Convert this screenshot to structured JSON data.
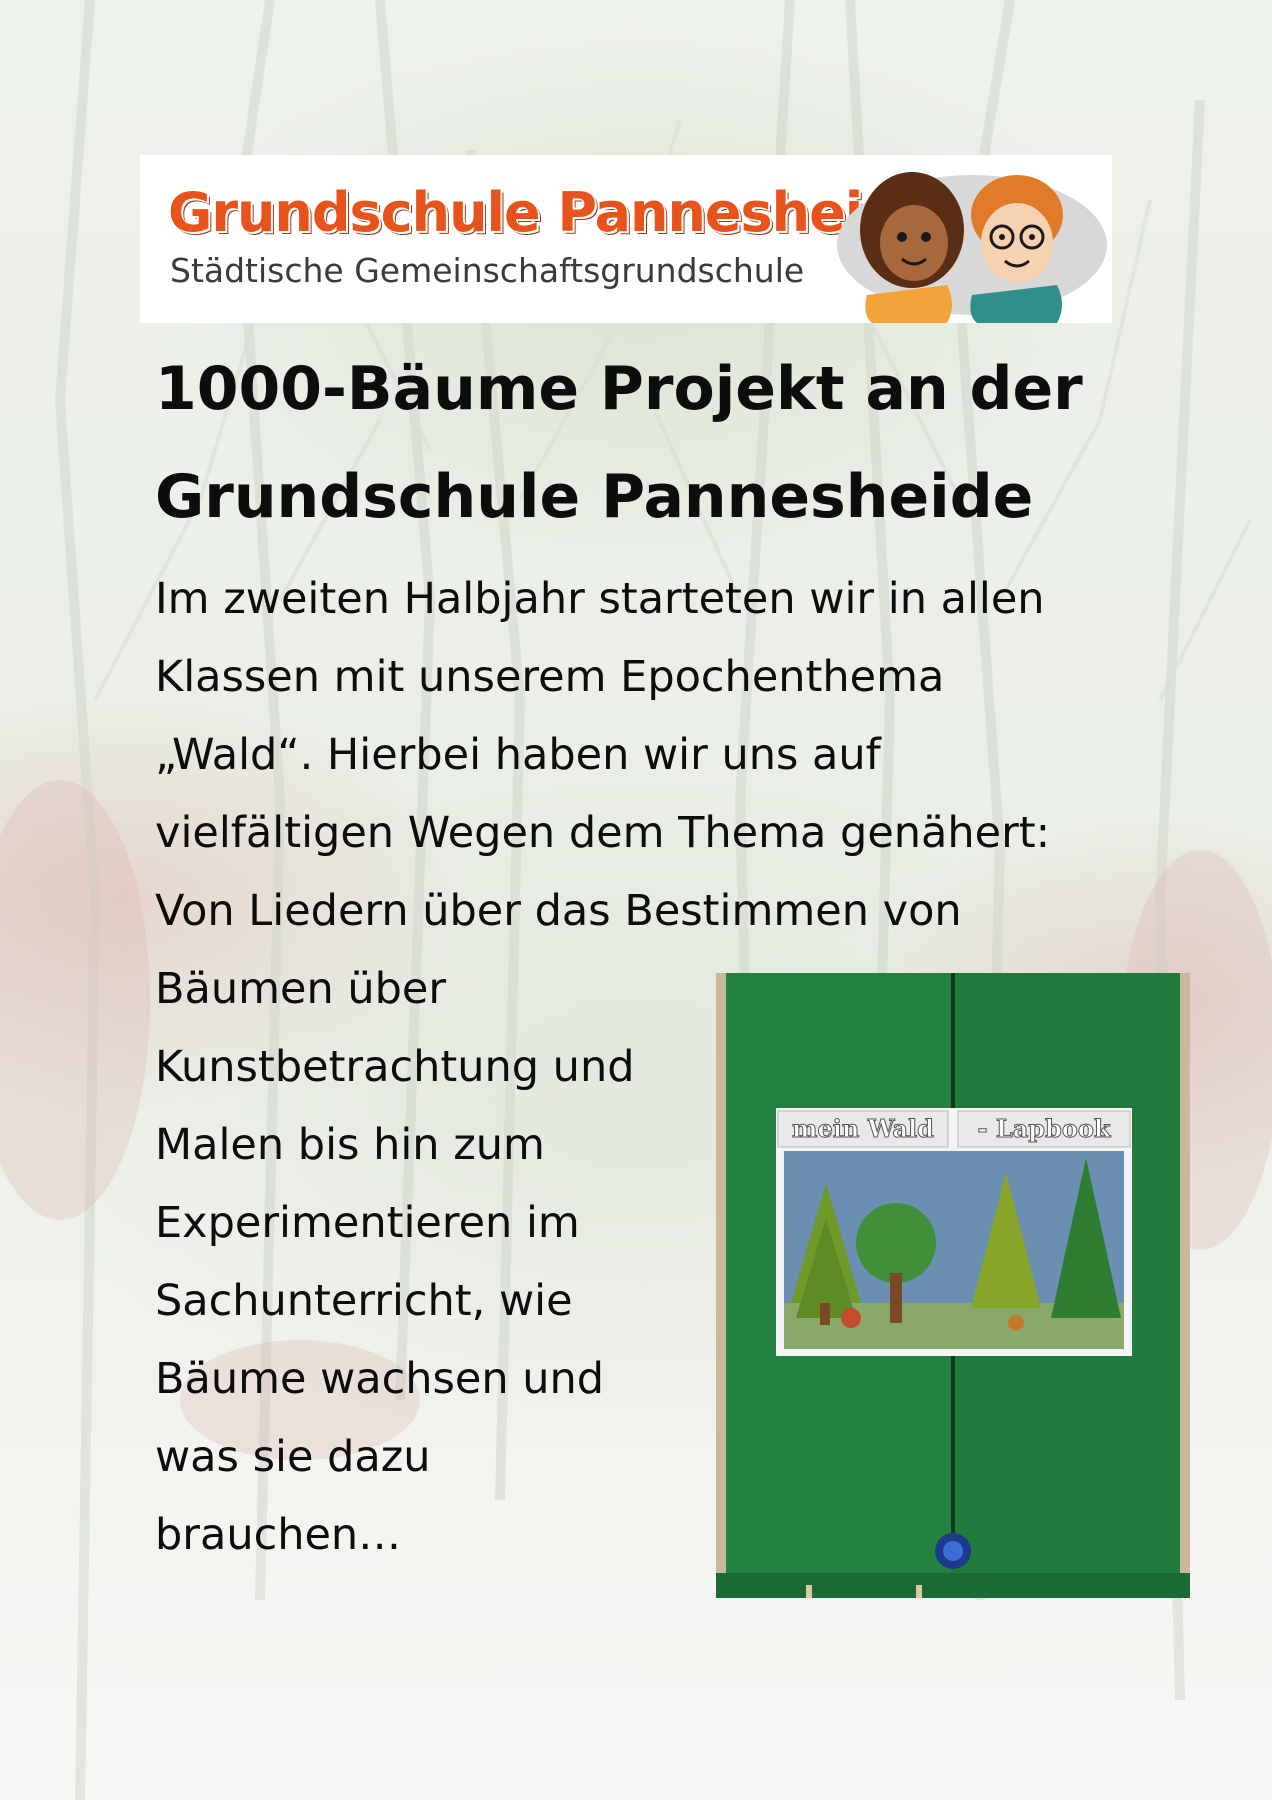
{
  "header": {
    "school_name": "Grundschule Pannesheide",
    "school_subtitle": "Städtische Gemeinschaftsgrundschule",
    "mascot_icon": "children-mascot-icon"
  },
  "title_lines": [
    "1000-Bäume Projekt an der",
    "Grundschule Pannesheide"
  ],
  "paragraph_lines": [
    "Im zweiten Halbjahr starteten wir in allen",
    "Klassen mit unserem Epochenthema",
    "„Wald“. Hierbei haben wir uns auf",
    "vielfältigen Wegen dem Thema genähert:",
    "Von Liedern über das Bestimmen von"
  ],
  "paragraph_lines_narrow": [
    "Bäumen über",
    "Kunstbetrachtung und",
    "Malen bis hin zum",
    "Experimentieren im",
    "Sachunterricht, wie",
    "Bäume wachsen und",
    "was sie dazu",
    "brauchen…"
  ],
  "photo": {
    "label_left": "mein Wald",
    "label_right": "- Lapbook",
    "folder_color": "#1f7a3c"
  },
  "colors": {
    "brand_orange": "#e8531c",
    "text": "#0d0d0d"
  }
}
